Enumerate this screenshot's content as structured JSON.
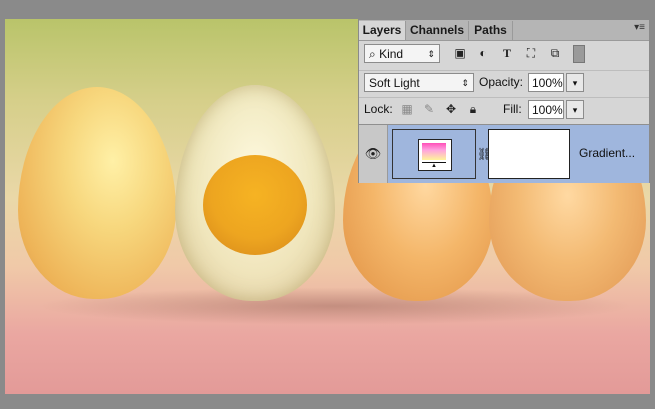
{
  "panel": {
    "tabs": [
      {
        "label": "Layers",
        "active": true
      },
      {
        "label": "Channels",
        "active": false
      },
      {
        "label": "Paths",
        "active": false
      }
    ],
    "filter": {
      "label": "Kind"
    },
    "blend_mode": "Soft Light",
    "opacity": {
      "label": "Opacity:",
      "value": "100%"
    },
    "lock": {
      "label": "Lock:"
    },
    "fill": {
      "label": "Fill:",
      "value": "100%"
    },
    "layers": [
      {
        "name": "Gradient...",
        "visible": true,
        "selected": true
      }
    ]
  },
  "colors": {
    "panel_bg": "#d6d6d6",
    "selected_layer": "#9fb6dd",
    "frame": "#8a8a8a"
  },
  "icons": {
    "filter_tools": [
      "image-filter-icon",
      "adjustment-filter-icon",
      "type-filter-icon",
      "shape-filter-icon",
      "smart-object-filter-icon",
      "filter-toggle-icon"
    ],
    "lock_tools": [
      "lock-transparent-icon",
      "lock-image-icon",
      "lock-position-icon",
      "lock-all-icon"
    ]
  }
}
